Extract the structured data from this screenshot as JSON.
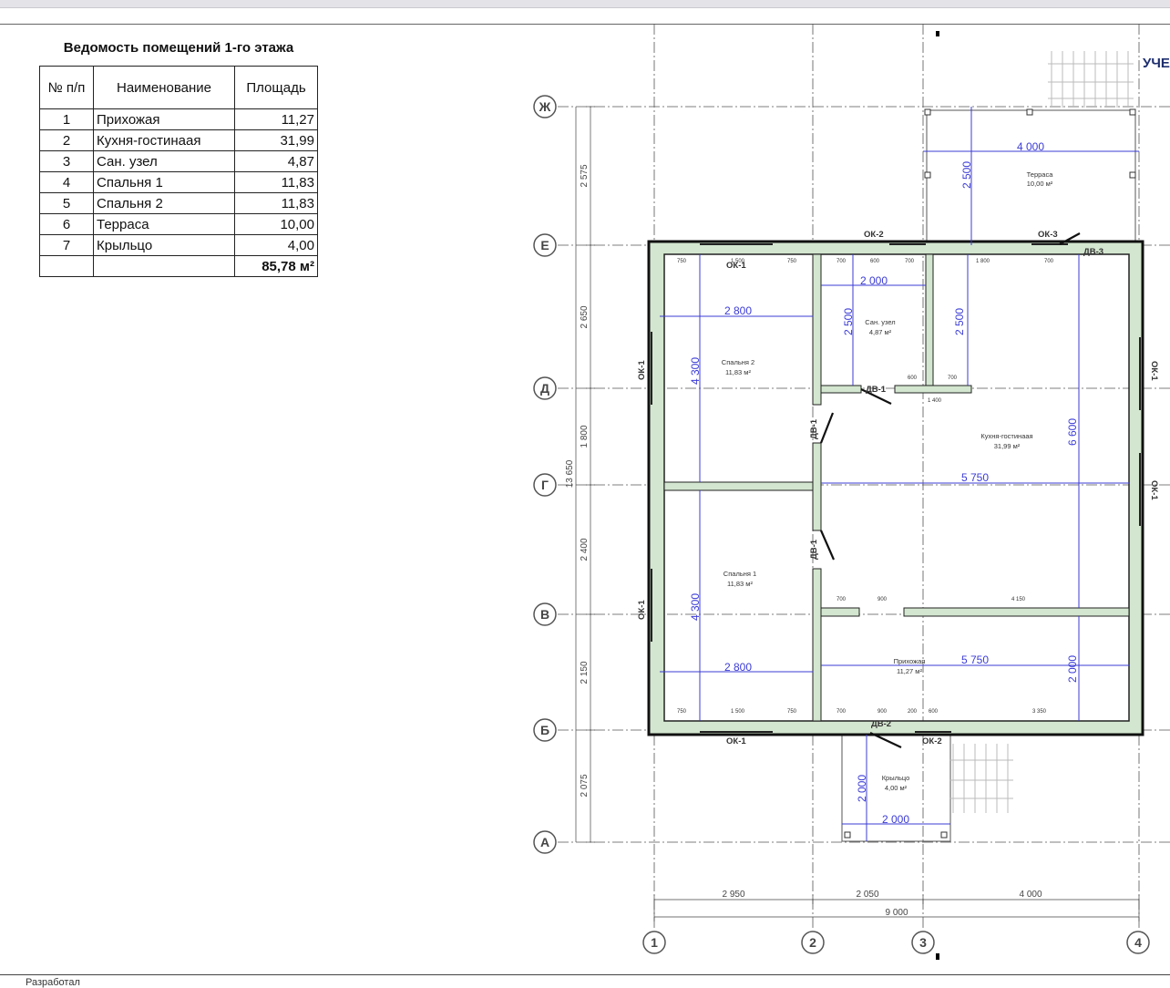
{
  "table": {
    "title": "Ведомость помещений 1-го этажа",
    "headers": [
      "№ п/п",
      "Наименование",
      "Площадь"
    ],
    "rows": [
      {
        "num": "1",
        "name": "Прихожая",
        "area": "11,27"
      },
      {
        "num": "2",
        "name": "Кухня-гостинаая",
        "area": "31,99"
      },
      {
        "num": "3",
        "name": "Сан. узел",
        "area": "4,87"
      },
      {
        "num": "4",
        "name": "Спальня 1",
        "area": "11,83"
      },
      {
        "num": "5",
        "name": "Спальня 2",
        "area": "11,83"
      },
      {
        "num": "6",
        "name": "Терраса",
        "area": "10,00"
      },
      {
        "num": "7",
        "name": "Крыльцо",
        "area": "4,00"
      }
    ],
    "total": "85,78 м²"
  },
  "plan": {
    "corner_text": "УЧЕ",
    "axes_rows": [
      "Ж",
      "Е",
      "Д",
      "Г",
      "В",
      "Б",
      "А"
    ],
    "axes_cols": [
      "1",
      "2",
      "3",
      "4"
    ],
    "left_dims": [
      "2 575",
      "2 650",
      "1 800",
      "2 400",
      "2 150",
      "2 075"
    ],
    "left_total": "13 650",
    "bottom_dims": [
      "2 950",
      "2 050",
      "4 000"
    ],
    "bottom_total": "9 000",
    "rooms": {
      "terrace_name": "Терраса",
      "terrace_area": "10,00 м²",
      "bath_name": "Сан. узел",
      "bath_area": "4,87 м²",
      "kitchen_name": "Кухня-гостинаая",
      "kitchen_area": "31,99 м²",
      "bed2_name": "Спальня 2",
      "bed2_area": "11,83 м²",
      "bed1_name": "Спальня 1",
      "bed1_area": "11,83 м²",
      "hall_name": "Прихожая",
      "hall_area": "11,27 м²",
      "porch_name": "Крыльцо",
      "porch_area": "4,00 м²"
    },
    "blue_dims": {
      "terrace_w": "4 000",
      "terrace_h": "2 500",
      "bath_w": "2 000",
      "bath_h1": "2 500",
      "bath_h2": "2 500",
      "bed2_w": "2 800",
      "bed2_h": "4 300",
      "bed1_w": "2 800",
      "bed1_h": "4 300",
      "kitchen_w": "5 750",
      "kitchen_h": "6 600",
      "hall_w": "5 750",
      "hall_h": "2 000",
      "porch_w": "2 000",
      "porch_h": "2 000"
    },
    "openings": {
      "ok1_top": "ОК-1",
      "ok2_top": "ОК-2",
      "ok3_top": "ОК-3",
      "dv3": "ДВ-3",
      "ok1_left_a": "ОК-1",
      "ok1_left_b": "ОК-1",
      "ok1_right_a": "ОК-1",
      "ok1_right_b": "ОК-1",
      "dv1_bath": "ДВ-1",
      "dv1_bed2": "ДВ-1",
      "dv1_bed1": "ДВ-1",
      "dv2": "ДВ-2",
      "ok1_bottom": "ОК-1",
      "ok2_bottom": "ОК-2"
    },
    "wall_dims": {
      "t1": "750",
      "t2": "1 500",
      "t3": "750",
      "t4": "700",
      "t5": "600",
      "t6": "700",
      "t7": "1 800",
      "t8": "700",
      "b1": "750",
      "b2": "1 500",
      "b3": "750",
      "b4": "700",
      "b5": "900",
      "b6": "200",
      "b7": "600",
      "b8": "3 350",
      "i1": "700",
      "i2": "900",
      "i3": "4 150",
      "i4": "600",
      "i5": "700",
      "i6": "1 400"
    }
  },
  "footer": {
    "left_text": "Разработал"
  }
}
